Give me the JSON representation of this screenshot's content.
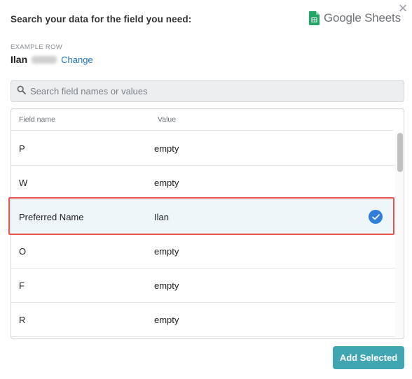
{
  "header": {
    "title": "Search your data for the field you need:",
    "close_symbol": "×",
    "brand_name": "Google Sheets",
    "brand_icon": "google-sheets-icon"
  },
  "example": {
    "label": "EXAMPLE ROW",
    "name": "Ilan",
    "change_label": "Change"
  },
  "search": {
    "placeholder": "Search field names or values",
    "value": "",
    "icon": "search-icon"
  },
  "table": {
    "columns": [
      "Field name",
      "Value"
    ],
    "rows": [
      {
        "field": "P",
        "value": "empty",
        "selected": false
      },
      {
        "field": "W",
        "value": "empty",
        "selected": false
      },
      {
        "field": "Preferred Name",
        "value": "Ilan",
        "selected": true
      },
      {
        "field": "O",
        "value": "empty",
        "selected": false
      },
      {
        "field": "F",
        "value": "empty",
        "selected": false
      },
      {
        "field": "R",
        "value": "empty",
        "selected": false
      }
    ]
  },
  "actions": {
    "add_selected_label": "Add Selected"
  },
  "colors": {
    "accent_button": "#3fa6b2",
    "link": "#1a73c8",
    "check": "#2f7fd8",
    "highlight_border": "#e8574f",
    "selected_row": "#eef6fa"
  }
}
